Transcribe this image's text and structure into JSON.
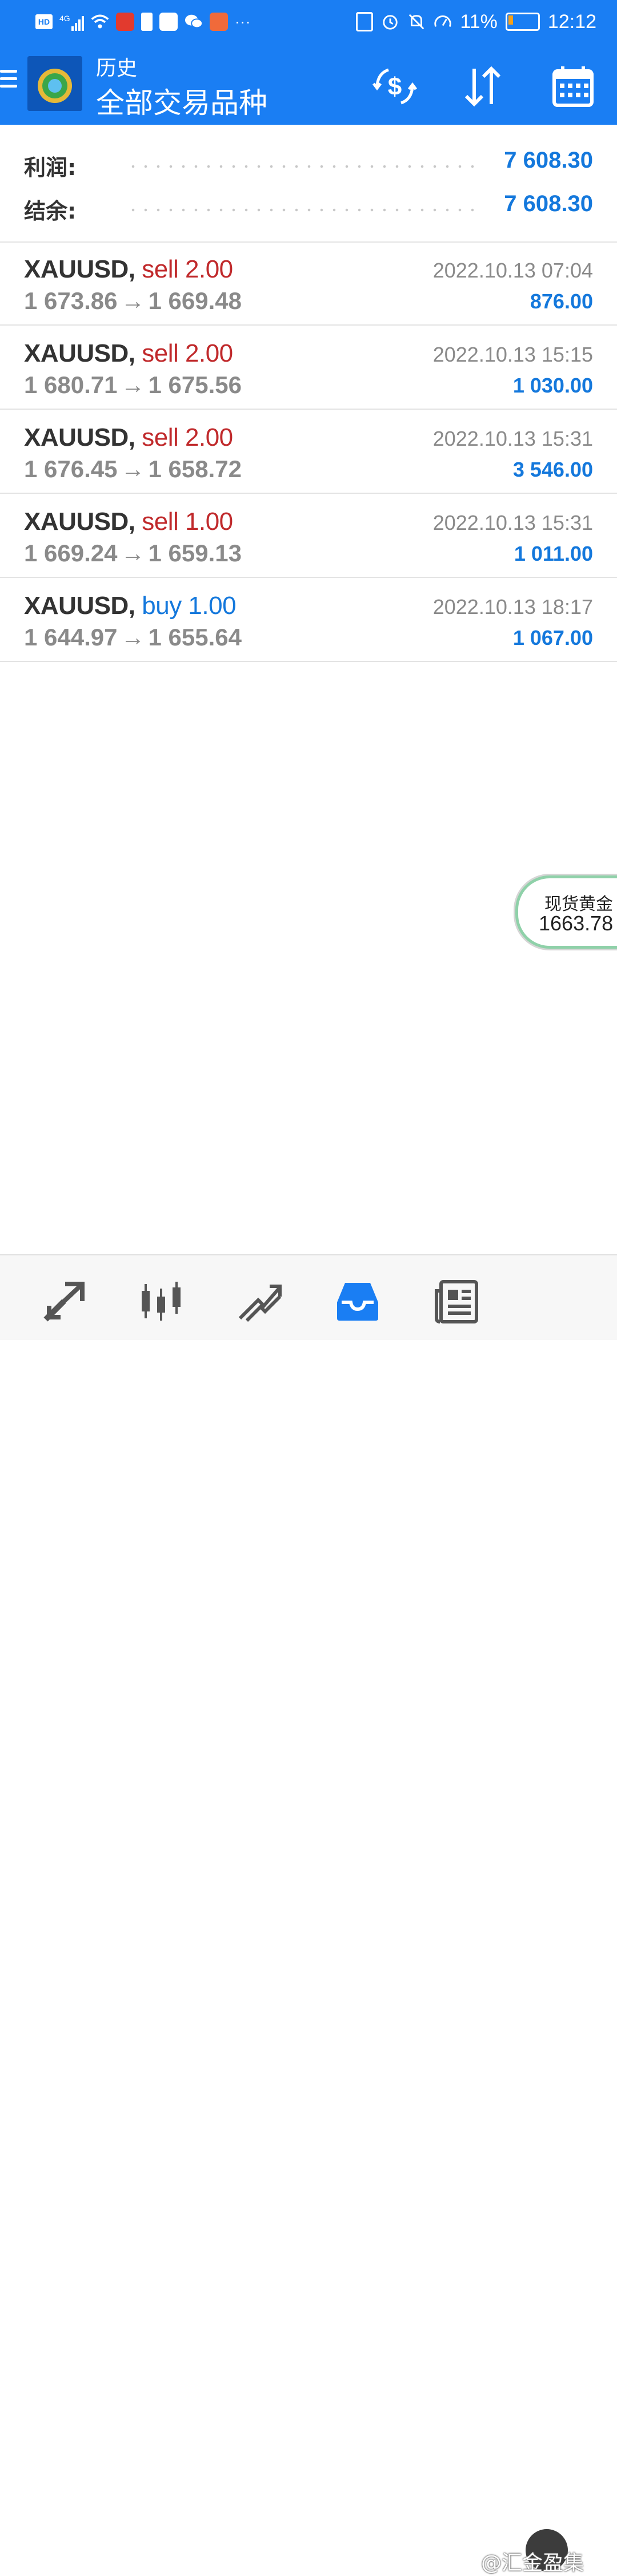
{
  "status_bar": {
    "network": "4G",
    "battery": "11%",
    "time": "12:12",
    "more": "···",
    "hd": "HD"
  },
  "app_bar": {
    "subtitle": "历史",
    "title": "全部交易品种"
  },
  "summary": {
    "profit_label": "利润:",
    "profit_value": "7 608.30",
    "balance_label": "结余:",
    "balance_value": "7 608.30"
  },
  "trades": [
    {
      "symbol": "XAUUSD,",
      "type": "sell 2.00",
      "side": "sell",
      "open": "1 673.86",
      "arrow": "→",
      "close": "1 669.48",
      "date": "2022.10.13 07:04",
      "profit": "876.00"
    },
    {
      "symbol": "XAUUSD,",
      "type": "sell 2.00",
      "side": "sell",
      "open": "1 680.71",
      "arrow": "→",
      "close": "1 675.56",
      "date": "2022.10.13 15:15",
      "profit": "1 030.00"
    },
    {
      "symbol": "XAUUSD,",
      "type": "sell 2.00",
      "side": "sell",
      "open": "1 676.45",
      "arrow": "→",
      "close": "1 658.72",
      "date": "2022.10.13 15:31",
      "profit": "3 546.00"
    },
    {
      "symbol": "XAUUSD,",
      "type": "sell 1.00",
      "side": "sell",
      "open": "1 669.24",
      "arrow": "→",
      "close": "1 659.13",
      "date": "2022.10.13 15:31",
      "profit": "1 011.00"
    },
    {
      "symbol": "XAUUSD,",
      "type": "buy 1.00",
      "side": "buy",
      "open": "1 644.97",
      "arrow": "→",
      "close": "1 655.64",
      "date": "2022.10.13 18:17",
      "profit": "1 067.00"
    }
  ],
  "float_widget": {
    "name": "现货黄金",
    "price": "1663.78"
  },
  "watermark": "@汇金盈集",
  "colors": {
    "primary": "#1a7ef3",
    "sell": "#c0292b",
    "buy": "#1478dc",
    "profit": "#1478dc",
    "muted": "#8a8a8a"
  },
  "icons": {
    "toolbar": [
      "currency-exchange-icon",
      "sort-icon",
      "calendar-icon"
    ],
    "bottom_nav": [
      "quotes-icon",
      "chart-icon",
      "trade-icon",
      "history-icon",
      "news-icon",
      "chat-icon"
    ]
  }
}
